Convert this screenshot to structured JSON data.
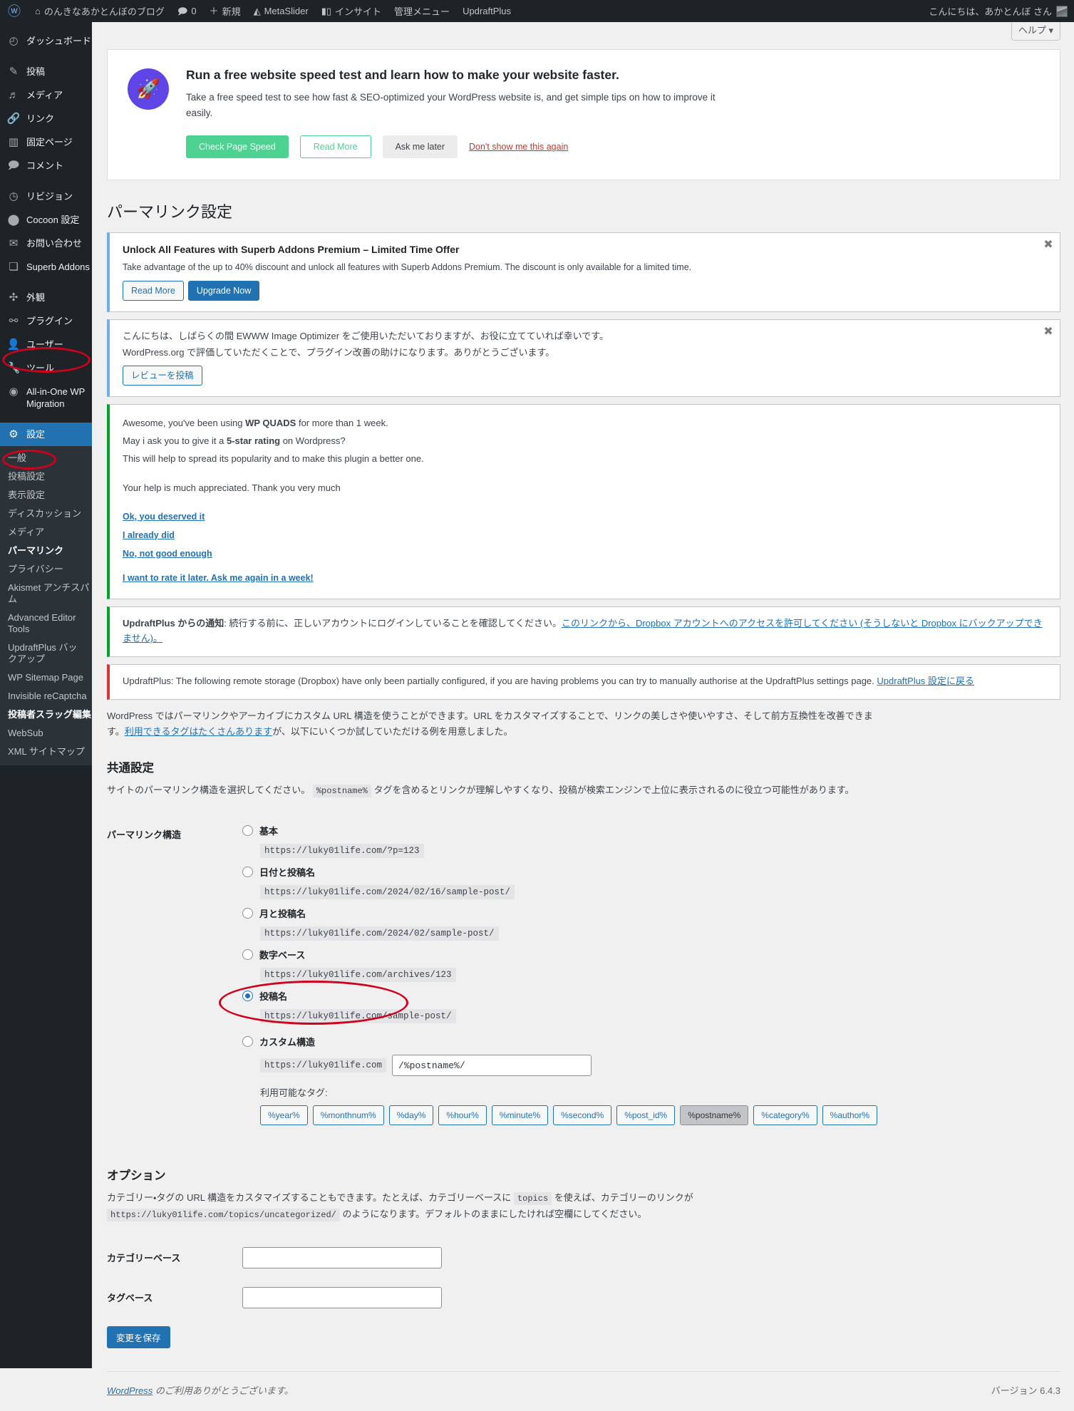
{
  "adminbar": {
    "logo_icon": "wordpress-logo-icon",
    "items": [
      {
        "icon": "home-icon",
        "label": "のんきなあかとんぼのブログ"
      },
      {
        "icon": "comment-icon",
        "label": "0"
      },
      {
        "icon": "plus-icon",
        "label": "新規"
      },
      {
        "icon": "metaslider-icon",
        "label": "MetaSlider"
      },
      {
        "icon": "chart-icon",
        "label": "インサイト"
      },
      {
        "icon": "",
        "label": "管理メニュー"
      },
      {
        "icon": "",
        "label": "UpdraftPlus"
      }
    ],
    "greeting": "こんにちは、あかとんぼ さん"
  },
  "sidebar": {
    "groups": [
      {
        "items": [
          {
            "icon": "dashboard-icon",
            "glyph": "◴",
            "label": "ダッシュボード"
          }
        ]
      },
      {
        "items": [
          {
            "icon": "pin-icon",
            "glyph": "✎",
            "label": "投稿"
          },
          {
            "icon": "media-icon",
            "glyph": "♪",
            "label": "メディア"
          },
          {
            "icon": "link-icon",
            "glyph": "🔗",
            "label": "リンク"
          },
          {
            "icon": "page-icon",
            "glyph": "▤",
            "label": "固定ページ"
          },
          {
            "icon": "comment-icon",
            "glyph": "🗩",
            "label": "コメント"
          }
        ]
      },
      {
        "items": [
          {
            "icon": "clock-icon",
            "glyph": "◷",
            "label": "リビジョン"
          },
          {
            "icon": "cocoon-icon",
            "glyph": "●",
            "label": "Cocoon 設定"
          },
          {
            "icon": "mail-icon",
            "glyph": "✉",
            "label": "お問い合わせ"
          },
          {
            "icon": "blocks-icon",
            "glyph": "❏",
            "label": "Superb Addons"
          }
        ]
      },
      {
        "items": [
          {
            "icon": "appearance-icon",
            "glyph": "✣",
            "label": "外観"
          },
          {
            "icon": "plugin-icon",
            "glyph": "⚯",
            "label": "プラグイン"
          },
          {
            "icon": "user-icon",
            "glyph": "👤",
            "label": "ユーザー"
          },
          {
            "icon": "tools-icon",
            "glyph": "🔧",
            "label": "ツール"
          },
          {
            "icon": "migration-icon",
            "glyph": "◉",
            "label": "All-in-One WP Migration"
          }
        ]
      }
    ],
    "settings": {
      "icon": "settings-icon",
      "glyph": "⚙",
      "label": "設定",
      "submenu": [
        {
          "label": "一般"
        },
        {
          "label": "投稿設定"
        },
        {
          "label": "表示設定"
        },
        {
          "label": "ディスカッション"
        },
        {
          "label": "メディア"
        },
        {
          "label": "パーマリンク",
          "current": true
        },
        {
          "label": "プライバシー"
        },
        {
          "label": "Akismet アンチスパム"
        },
        {
          "label": "Advanced Editor Tools"
        },
        {
          "label": "UpdraftPlus バックアップ"
        },
        {
          "label": "WP Sitemap Page"
        },
        {
          "label": "Invisible reCaptcha"
        },
        {
          "label": "投稿者スラッグ編集"
        },
        {
          "label": "WebSub"
        },
        {
          "label": "XML サイトマップ"
        }
      ]
    }
  },
  "help_tab": "ヘルプ ▾",
  "speed_banner": {
    "icon": "rocket-icon",
    "heading": "Run a free website speed test and learn how to make your website faster.",
    "body": "Take a free speed test to see how fast & SEO-optimized your WordPress website is, and get simple tips on how to improve it easily.",
    "btn_primary": "Check Page Speed",
    "btn_outline": "Read More",
    "btn_grey": "Ask me later",
    "link_dismiss": "Don't show me this again"
  },
  "page_title": "パーマリンク設定",
  "notices": {
    "superb": {
      "heading": "Unlock All Features with Superb Addons Premium – Limited Time Offer",
      "body": "Take advantage of the up to 40% discount and unlock all features with Superb Addons Premium. The discount is only available for a limited time.",
      "btn_read": "Read More",
      "btn_upgrade": "Upgrade Now",
      "dismiss_icon": "close-circle-icon"
    },
    "ewww": {
      "line1": "こんにちは、しばらくの間 EWWW Image Optimizer をご使用いただいておりますが、お役に立てていれば幸いです。",
      "line2": "WordPress.org で評価していただくことで、プラグイン改善の助けになります。ありがとうございます。",
      "btn": "レビューを投稿",
      "dismiss_icon": "close-circle-icon"
    },
    "quads": {
      "line1_a": "Awesome, you've been using ",
      "line1_b": "WP QUADS",
      "line1_c": " for more than 1 week.",
      "line2_a": "May i ask you to give it a ",
      "line2_b": "5-star rating",
      "line2_c": " on Wordpress?",
      "line3": "This will help to spread its popularity and to make this plugin a better one.",
      "line4": "Your help is much appreciated. Thank you very much",
      "links": [
        "Ok, you deserved it",
        "I already did",
        "No, not good enough"
      ],
      "link_later": "I want to rate it later. Ask me again in a week!"
    },
    "updraft_info": {
      "bold": "UpdraftPlus からの通知",
      "text": ": 続行する前に、正しいアカウントにログインしていることを確認してください。",
      "link": "このリンクから、Dropbox アカウントへのアクセスを許可してください (そうしないと Dropbox にバックアップできません)。"
    },
    "updraft_err": {
      "text": "UpdraftPlus: The following remote storage (Dropbox) have only been partially configured, if you are having problems you can try to manually authorise at the UpdraftPlus settings page. ",
      "link": "UpdraftPlus 設定に戻る"
    }
  },
  "intro": {
    "text_a": "WordPress ではパーマリンクやアーカイブにカスタム URL 構造を使うことができます。URL をカスタマイズすることで、リンクの美しさや使いやすさ、そして前方互換性を改善できます。",
    "link": "利用できるタグはたくさんあります",
    "text_b": "が、以下にいくつか試していただける例を用意しました。"
  },
  "common_settings": {
    "heading": "共通設定",
    "desc_a": "サイトのパーマリンク構造を選択してください。",
    "code": "%postname%",
    "desc_b": "タグを含めるとリンクが理解しやすくなり、投稿が検索エンジンで上位に表示されるのに役立つ可能性があります。",
    "row_label": "パーマリンク構造",
    "options": [
      {
        "label": "基本",
        "url": "https://luky01life.com/?p=123",
        "selected": false
      },
      {
        "label": "日付と投稿名",
        "url": "https://luky01life.com/2024/02/16/sample-post/",
        "selected": false
      },
      {
        "label": "月と投稿名",
        "url": "https://luky01life.com/2024/02/sample-post/",
        "selected": false
      },
      {
        "label": "数字ベース",
        "url": "https://luky01life.com/archives/123",
        "selected": false
      },
      {
        "label": "投稿名",
        "url": "https://luky01life.com/sample-post/",
        "selected": true
      }
    ],
    "custom": {
      "label": "カスタム構造",
      "prefix": "https://luky01life.com",
      "value": "/%postname%/",
      "avail_label": "利用可能なタグ:",
      "tags": [
        {
          "label": "%year%",
          "active": false
        },
        {
          "label": "%monthnum%",
          "active": false
        },
        {
          "label": "%day%",
          "active": false
        },
        {
          "label": "%hour%",
          "active": false
        },
        {
          "label": "%minute%",
          "active": false
        },
        {
          "label": "%second%",
          "active": false
        },
        {
          "label": "%post_id%",
          "active": false
        },
        {
          "label": "%postname%",
          "active": true
        },
        {
          "label": "%category%",
          "active": false
        },
        {
          "label": "%author%",
          "active": false
        }
      ]
    }
  },
  "options_section": {
    "heading": "オプション",
    "desc_a": "カテゴリー・タグの URL 構造をカスタマイズすることもできます。たとえば、カテゴリーベースに",
    "code1": "topics",
    "desc_b": "を使えば、カテゴリーのリンクが",
    "code2": "https://luky01life.com/topics/uncategorized/",
    "desc_c": "のようになります。デフォルトのままにしたければ空欄にしてください。",
    "category_base": {
      "label": "カテゴリーベース",
      "value": ""
    },
    "tag_base": {
      "label": "タグベース",
      "value": ""
    },
    "submit": "変更を保存"
  },
  "footer": {
    "link": "WordPress",
    "thanks": " のご利用ありがとうございます。",
    "version": "バージョン 6.4.3"
  },
  "colors": {
    "admin_bg": "#1d2327",
    "accent": "#2271b1",
    "annotation": "#d0021b",
    "success": "#00a32a",
    "error": "#d63638",
    "green_btn": "#4dd291",
    "purple": "#5f45e6"
  }
}
